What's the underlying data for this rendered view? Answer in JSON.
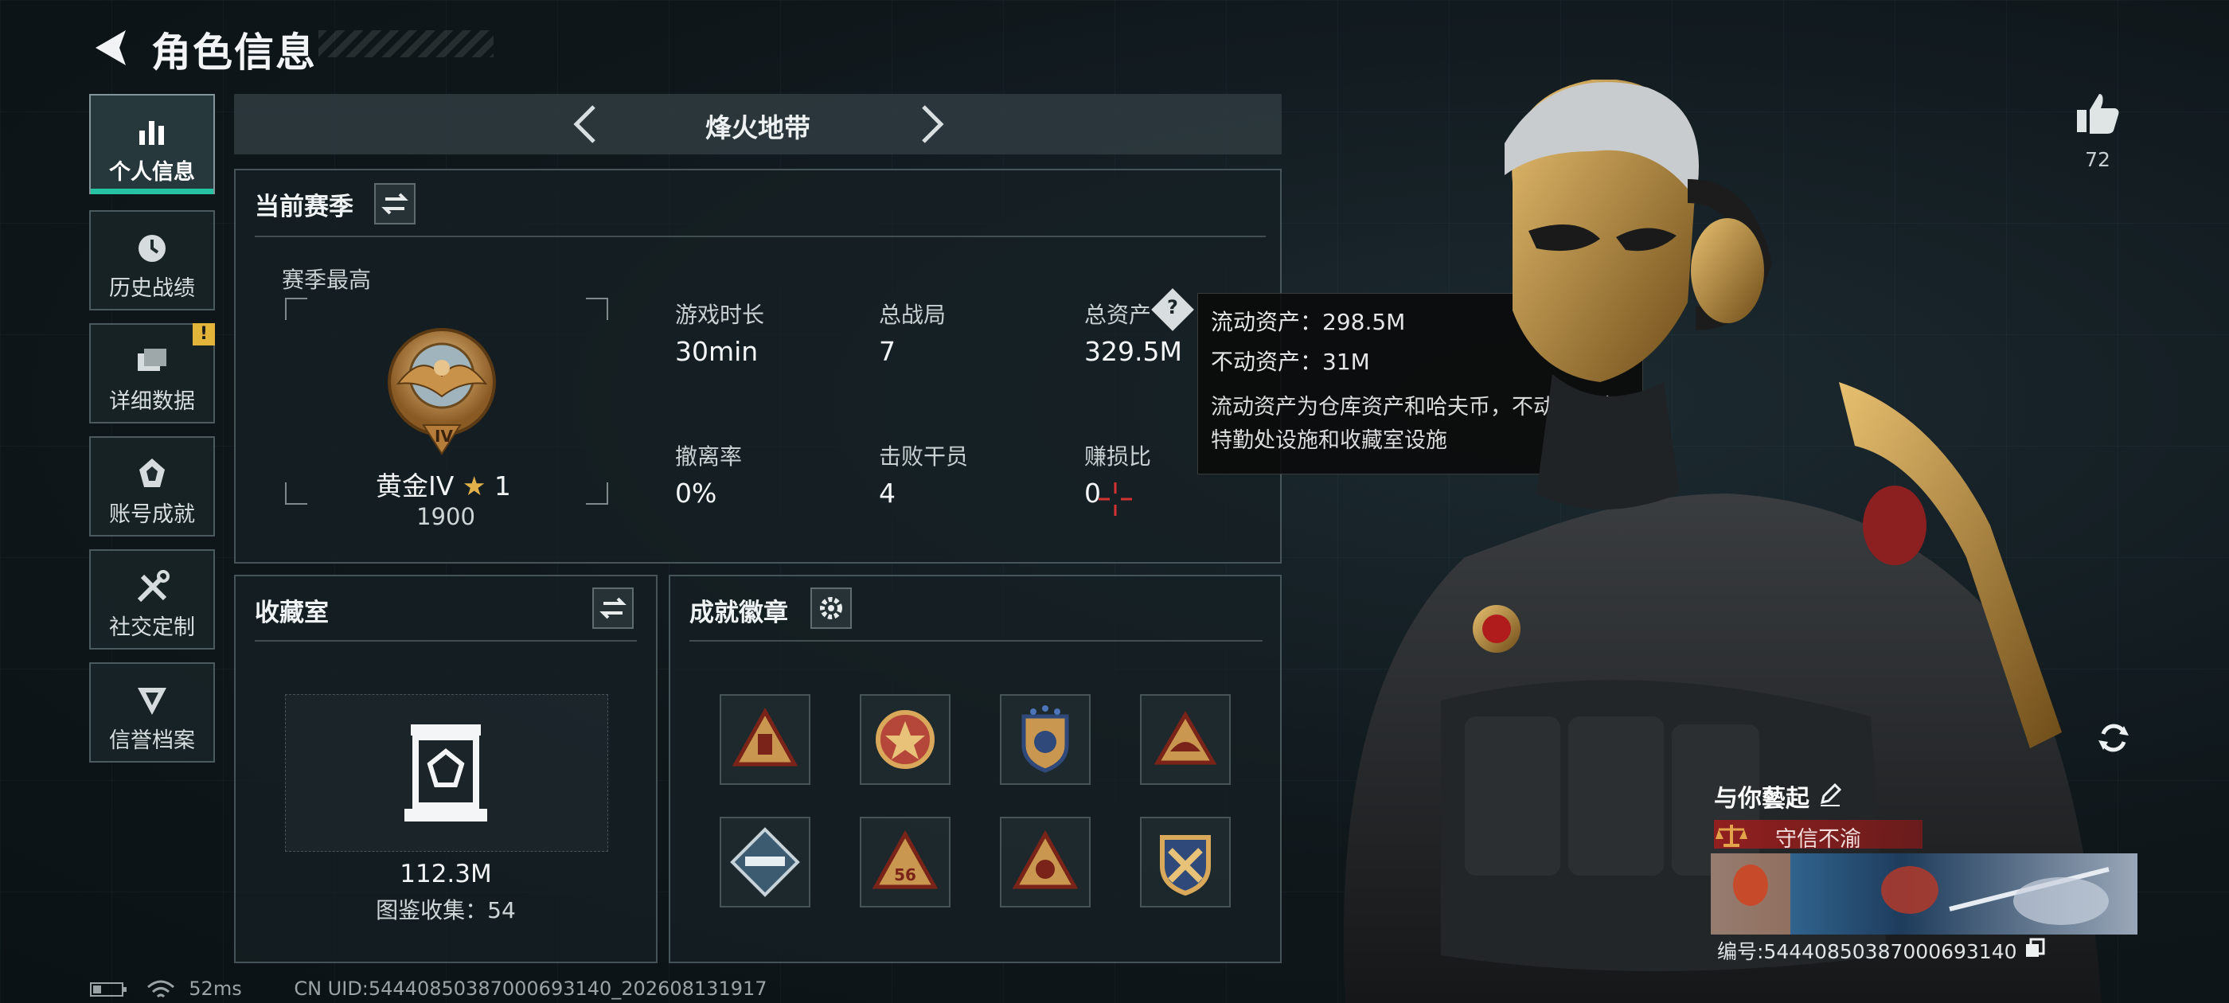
{
  "header": {
    "title": "角色信息"
  },
  "sidebar": {
    "items": [
      {
        "label": "个人信息",
        "icon": "bar-chart-icon",
        "active": true
      },
      {
        "label": "历史战绩",
        "icon": "history-icon"
      },
      {
        "label": "详细数据",
        "icon": "folder-icon",
        "alert": "!"
      },
      {
        "label": "账号成就",
        "icon": "achievement-icon"
      },
      {
        "label": "社交定制",
        "icon": "tools-icon"
      },
      {
        "label": "信誉档案",
        "icon": "reputation-icon"
      }
    ]
  },
  "mode": {
    "name": "烽火地带"
  },
  "season": {
    "title": "当前赛季",
    "best_label": "赛季最高",
    "rank_name": "黄金IV",
    "rank_stars": "1",
    "rank_points": "1900",
    "rank_numeral": "IV",
    "stats": [
      {
        "label": "游戏时长",
        "value": "30min"
      },
      {
        "label": "总战局",
        "value": "7"
      },
      {
        "label": "总资产",
        "value": "329.5M"
      },
      {
        "label": "撤离率",
        "value": "0%"
      },
      {
        "label": "击败干员",
        "value": "4"
      },
      {
        "label": "赚损比",
        "value": "0"
      }
    ]
  },
  "tooltip": {
    "liquid": "流动资产：298.5M",
    "fixed": "不动资产：31M",
    "description": "流动资产为仓库资产和哈夫币，不动资产为特勤处设施和收藏室设施"
  },
  "collection": {
    "title": "收藏室",
    "value": "112.3M",
    "catalog": "图鉴收集：54"
  },
  "badges": {
    "title": "成就徽章",
    "items": [
      "badge-1",
      "badge-2",
      "badge-3",
      "badge-4",
      "badge-5",
      "badge-6",
      "badge-7",
      "badge-8"
    ],
    "badge_number": "56"
  },
  "likes": {
    "count": "72"
  },
  "profile": {
    "name": "与你藝起",
    "title": "守信不渝",
    "id": "编号:5444085038700069314​0"
  },
  "status": {
    "ping": "52ms",
    "uid": "CN UID:5444085038700069314​0_202608131917"
  },
  "colors": {
    "accent": "#26c3a3",
    "gold": "#d4a447",
    "alert": "#e3b43a",
    "title_red": "#9a1e1e"
  }
}
